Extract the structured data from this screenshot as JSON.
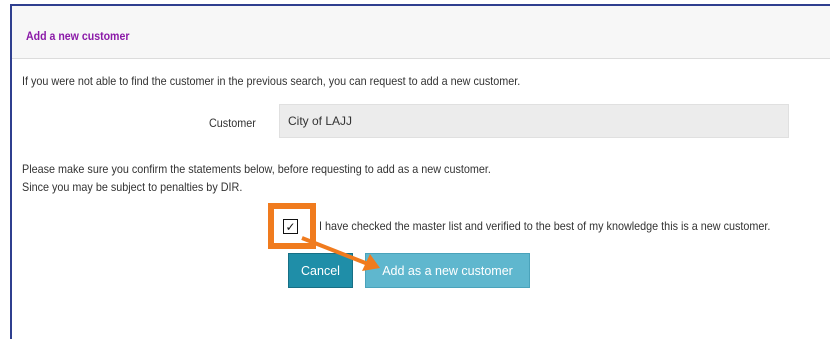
{
  "dialog": {
    "title": "Add a new customer",
    "intro": "If you were not able to find the customer in the previous search, you can request to add a new customer.",
    "customer_label": "Customer",
    "customer_value": "City of LAJJ",
    "confirm_line1": "Please make sure you confirm the statements below, before requesting to add as a new customer.",
    "confirm_line2": "Since you may be subject to penalties by DIR.",
    "checkbox": {
      "checked": true,
      "label": "I have checked the master list and verified to the best of my knowledge this is a new customer."
    },
    "buttons": {
      "cancel": "Cancel",
      "add": "Add as a new customer"
    }
  },
  "colors": {
    "title": "#8b1aa8",
    "cancel_button": "#1f8ea8",
    "add_button": "#5fb7ce",
    "annotation": "#f07b1e"
  }
}
